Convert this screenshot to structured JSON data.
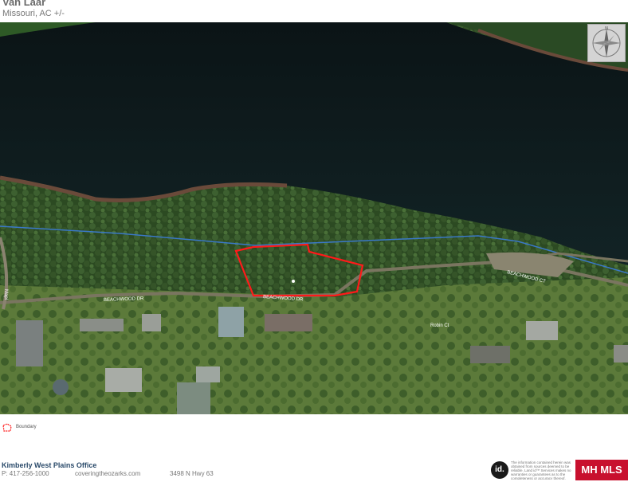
{
  "header": {
    "title": "Van Laar",
    "subtitle": "Missouri,  AC +/-"
  },
  "map": {
    "labels": {
      "road1": "BEACHWOOD DR",
      "road2": "BEACHWOOD DR",
      "road3": "BEACHWOOD CT",
      "road4": "Robin Ct",
      "road5": "Mapl"
    },
    "colors": {
      "water": "#0e1a1c",
      "forest": "#2f4a25",
      "boundary": "#ff1a1a",
      "parcel_line": "#3a78c8"
    }
  },
  "legend": {
    "label": "Boundary"
  },
  "footer": {
    "office": "Kimberly West Plains Office",
    "phone": "P: 417-256-1000",
    "website": "coveringtheozarks.com",
    "address": "3498 N Hwy 63",
    "disclaimer": "The information contained herein was obtained from sources deemed to be reliable. Land id™ Services makes no warranties or guarantees as to the completeness or accuracy thereof.",
    "landid_logo": "id.",
    "mls_badge": "MH MLS"
  }
}
